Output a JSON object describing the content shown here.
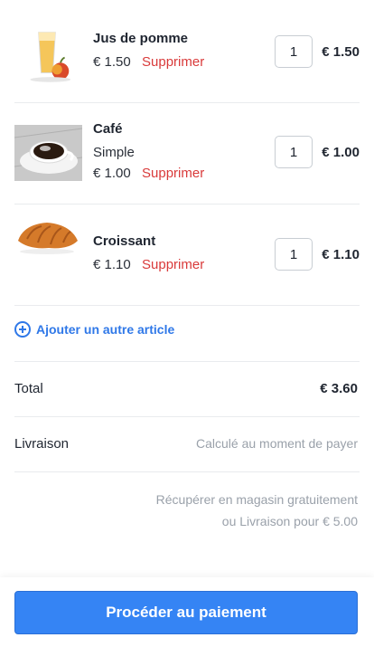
{
  "items": [
    {
      "name": "Jus de pomme",
      "variant": "",
      "price": "€ 1.50",
      "remove_label": "Supprimer",
      "quantity": "1",
      "line_total": "€ 1.50",
      "image_icon": "apple-juice-icon"
    },
    {
      "name": "Café",
      "variant": "Simple",
      "price": "€ 1.00",
      "remove_label": "Supprimer",
      "quantity": "1",
      "line_total": "€ 1.00",
      "image_icon": "coffee-cup-icon"
    },
    {
      "name": "Croissant",
      "variant": "",
      "price": "€ 1.10",
      "remove_label": "Supprimer",
      "quantity": "1",
      "line_total": "€ 1.10",
      "image_icon": "croissant-icon"
    }
  ],
  "add_item_label": "Ajouter un autre article",
  "summary": {
    "total_label": "Total",
    "total_value": "€ 3.60",
    "delivery_label": "Livraison",
    "delivery_value": "Calculé au moment de payer",
    "pickup_note": "Récupérer en magasin gratuitement ou Livraison pour € 5.00"
  },
  "checkout_label": "Procéder au paiement",
  "colors": {
    "accent": "#3584f4",
    "danger": "#d93a3a",
    "muted": "#9aa1aa"
  }
}
